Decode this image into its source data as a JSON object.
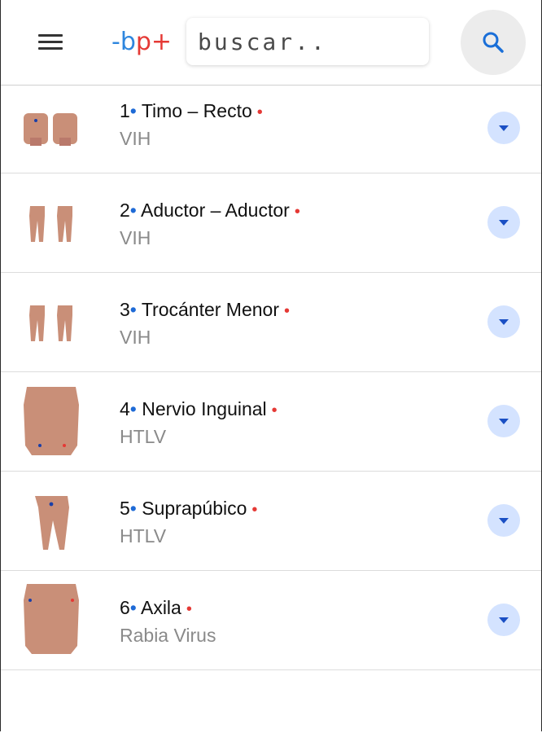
{
  "header": {
    "logo_part1": "-b",
    "logo_part2": "p+",
    "search_placeholder": "buscar.."
  },
  "items": [
    {
      "number": "1",
      "name": "Timo – Recto",
      "subtitle": "VIH"
    },
    {
      "number": "2",
      "name": "Aductor – Aductor",
      "subtitle": "VIH"
    },
    {
      "number": "3",
      "name": "Trocánter Menor",
      "subtitle": "VIH"
    },
    {
      "number": "4",
      "name": "Nervio Inguinal",
      "subtitle": "HTLV"
    },
    {
      "number": "5",
      "name": "Suprapúbico",
      "subtitle": "HTLV"
    },
    {
      "number": "6",
      "name": "Axila",
      "subtitle": "Rabia Virus"
    }
  ],
  "colors": {
    "logo_blue": "#2e86de",
    "logo_red": "#e53935",
    "bullet_blue": "#1e6ad6",
    "dot_red": "#e53935",
    "expand_bg": "#d4e3ff"
  },
  "icons": {
    "menu": "menu-icon",
    "search": "search-icon",
    "expand": "chevron-down-icon"
  }
}
